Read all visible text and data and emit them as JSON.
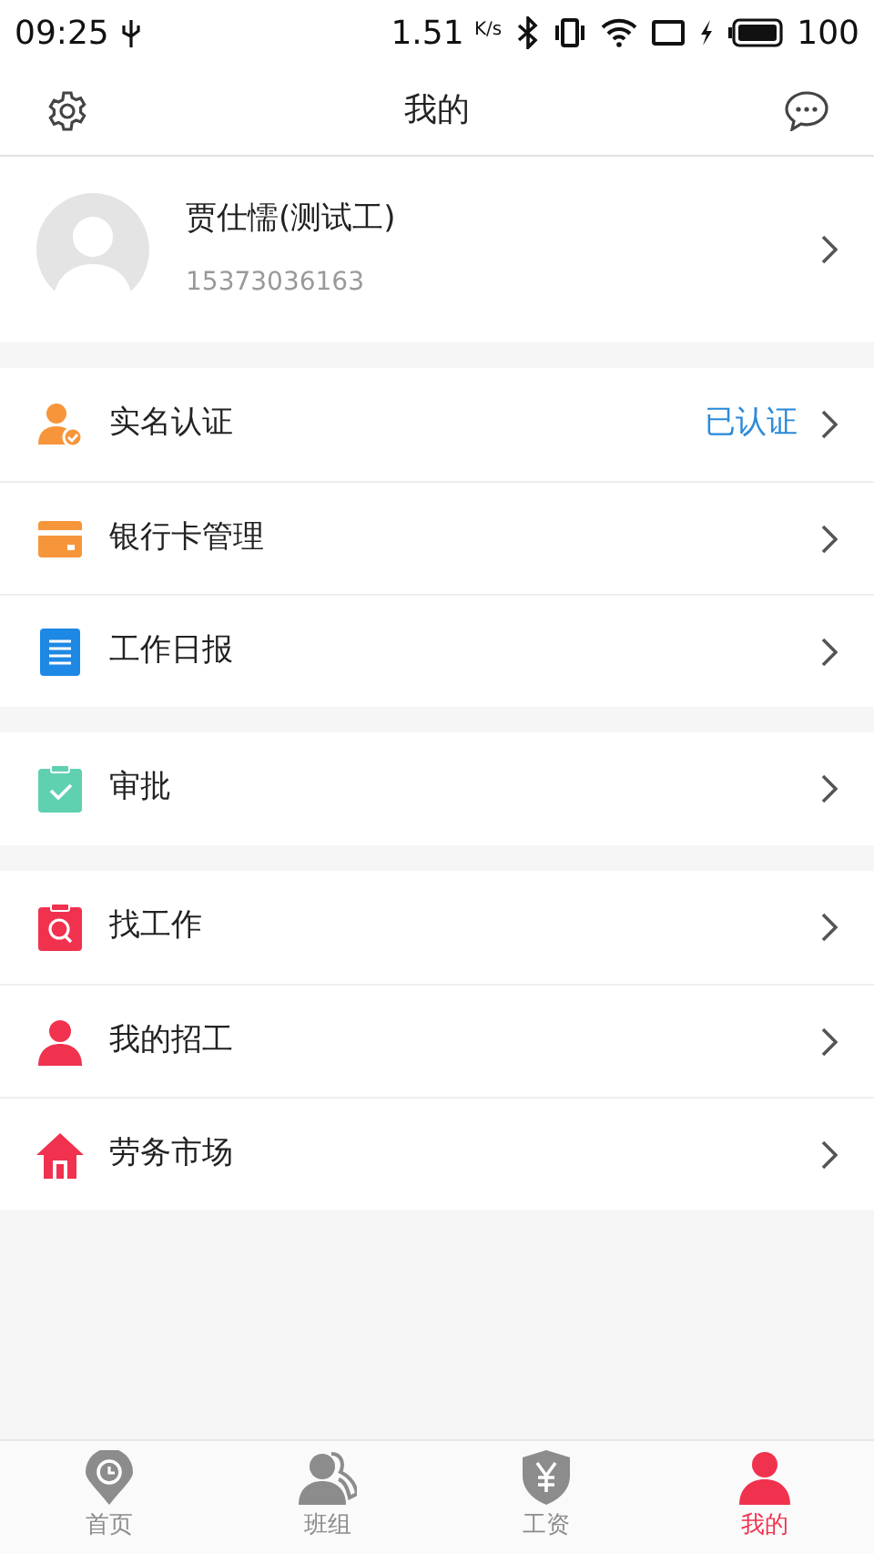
{
  "status_bar": {
    "time": "09:25",
    "speed": "1.51",
    "speed_unit": "K/s",
    "battery": "100"
  },
  "header": {
    "title": "我的"
  },
  "profile": {
    "name": "贾仕懦(测试工)",
    "phone": "15373036163"
  },
  "sections": [
    {
      "items": [
        {
          "kind": "identity",
          "label": "实名认证",
          "status": "已认证"
        },
        {
          "kind": "bankcard",
          "label": "银行卡管理"
        },
        {
          "kind": "report",
          "label": "工作日报"
        }
      ]
    },
    {
      "items": [
        {
          "kind": "approval",
          "label": "审批"
        }
      ]
    },
    {
      "items": [
        {
          "kind": "jobsearch",
          "label": "找工作"
        },
        {
          "kind": "recruit",
          "label": "我的招工"
        },
        {
          "kind": "market",
          "label": "劳务市场"
        }
      ]
    }
  ],
  "tabs": [
    {
      "kind": "home",
      "label": "首页",
      "selected": false
    },
    {
      "kind": "team",
      "label": "班组",
      "selected": false
    },
    {
      "kind": "wage",
      "label": "工资",
      "selected": false
    },
    {
      "kind": "mine",
      "label": "我的",
      "selected": true
    }
  ]
}
